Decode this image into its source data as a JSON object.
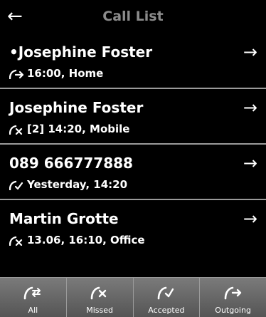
{
  "header": {
    "title": "Call List",
    "back_icon": "left-arrow-icon"
  },
  "calls": [
    {
      "name": "•Josephine Foster",
      "detail": "16:00, Home",
      "call_type_icon": "outgoing-call-icon"
    },
    {
      "name": "Josephine Foster",
      "detail": "[2] 14:20, Mobile",
      "call_type_icon": "missed-call-icon"
    },
    {
      "name": "089 666777888",
      "detail": "Yesterday, 14:20",
      "call_type_icon": "accepted-call-icon"
    },
    {
      "name": "Martin Grotte",
      "detail": "13.06, 16:10, Office",
      "call_type_icon": "missed-call-icon"
    }
  ],
  "tabs": [
    {
      "label": "All",
      "icon": "all-calls-icon"
    },
    {
      "label": "Missed",
      "icon": "missed-call-icon"
    },
    {
      "label": "Accepted",
      "icon": "accepted-call-icon"
    },
    {
      "label": "Outgoing",
      "icon": "outgoing-call-icon"
    }
  ],
  "colors": {
    "background": "#000000",
    "title": "#8c8c8c",
    "divider": "#9a9a9a",
    "tab_bar": "#6a6a6a"
  }
}
